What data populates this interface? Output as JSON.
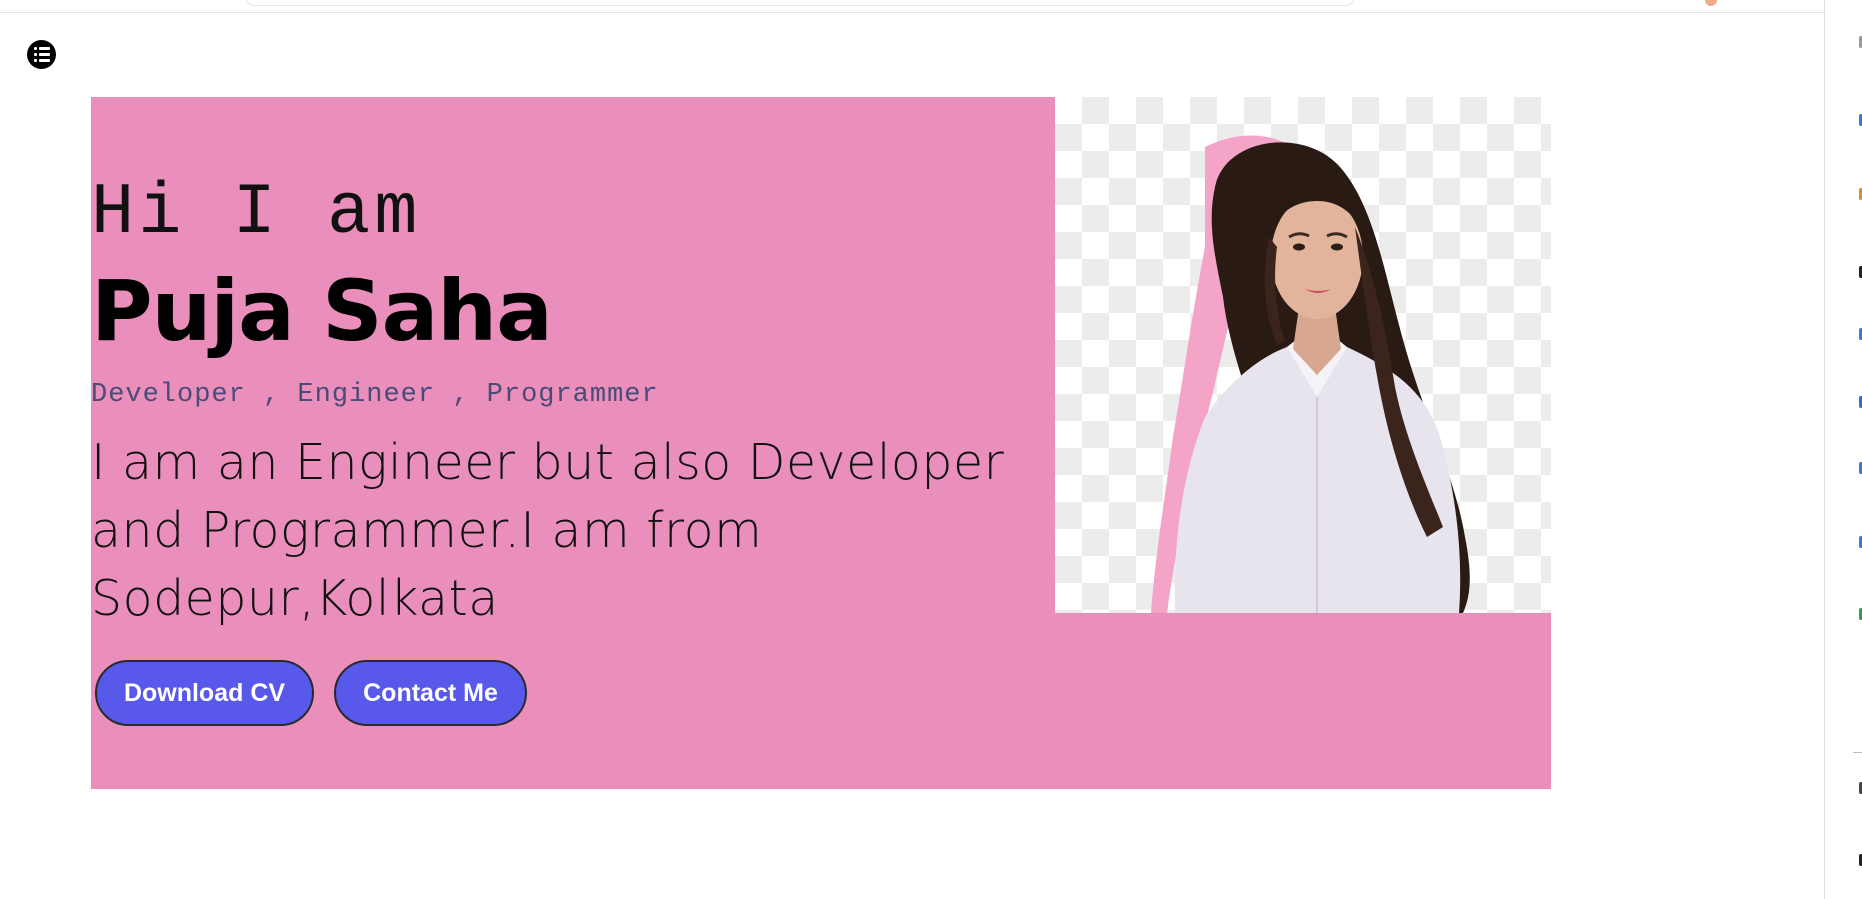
{
  "nav": {
    "menu_icon": "list-icon"
  },
  "hero": {
    "greeting": "Hi I am",
    "name": "Puja Saha",
    "roles": "Developer , Engineer , Programmer",
    "bio_lines": [
      "I am an Engineer but also Developer",
      "and Programmer.I am from",
      "Sodepur,Kolkata"
    ],
    "buttons": {
      "download_cv": "Download CV",
      "contact_me": "Contact Me"
    }
  },
  "colors": {
    "hero_bg": "#ea8fbc",
    "button_bg": "#5858ea",
    "roles_text": "#4b4b78"
  }
}
